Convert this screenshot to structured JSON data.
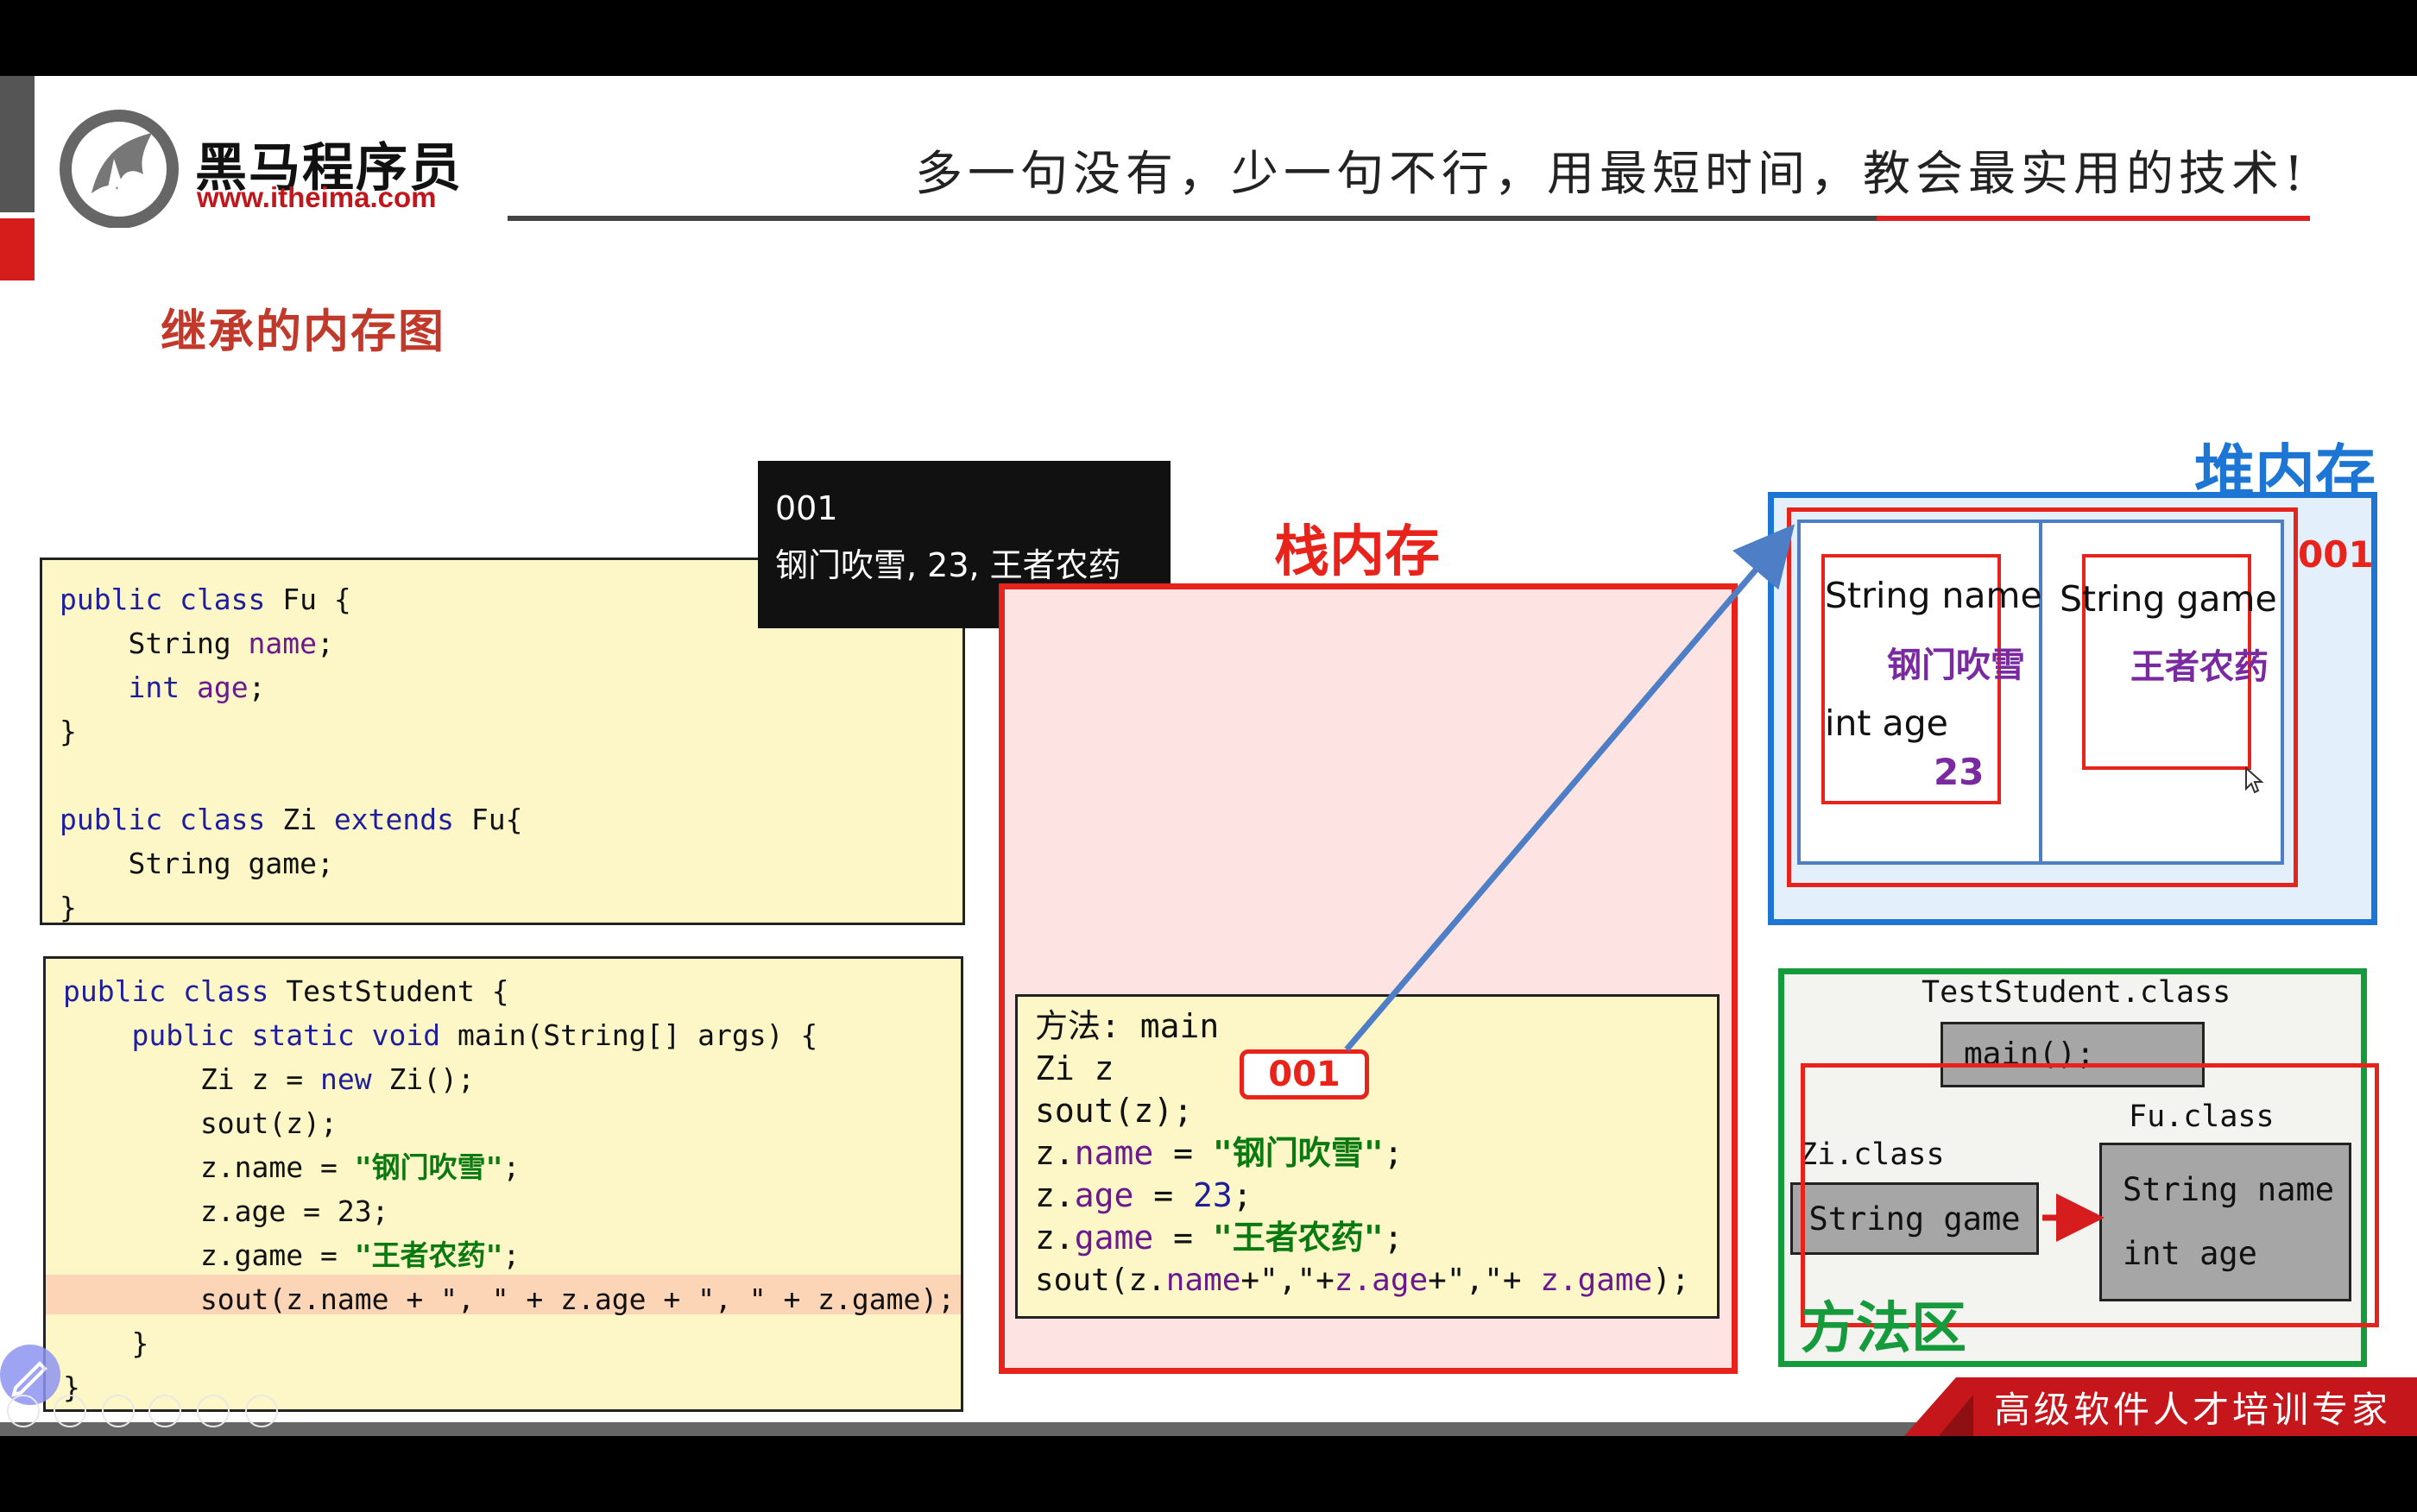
{
  "brand": {
    "logo_name": "黑马程序员",
    "url": "www.itheima.com",
    "slogan": "多一句没有，少一句不行，用最短时间，教会最实用的技术!",
    "footer": "高级软件人才培训专家"
  },
  "slide": {
    "title": "继承的内存图",
    "tooltip": {
      "line1": "001",
      "line2": "钢门吹雪, 23, 王者农药"
    },
    "stack_label": "栈内存",
    "heap_label": "堆内存",
    "method_area_label": "方法区"
  },
  "code_fu": {
    "l1a": "public class",
    "l1b": " Fu {",
    "l2a": "    String ",
    "l2b": "name",
    "l2c": ";",
    "l3a": "    int ",
    "l3b": "age",
    "l3c": ";",
    "l4": "}",
    "l5a": "public class",
    "l5b": " Zi ",
    "l5c": "extends",
    "l5d": " Fu{",
    "l6": "    String game;",
    "l7": "}"
  },
  "code_test": {
    "l1a": "public class",
    "l1b": " TestStudent {",
    "l2a": "    public static void",
    "l2b": " main(String[] args) {",
    "l3a": "        Zi z = ",
    "l3b": "new",
    "l3c": " Zi();",
    "l4": "        sout(z);",
    "l5a": "        z.name = ",
    "l5b": "\"钢门吹雪\"",
    "l5c": ";",
    "l6": "        z.age = 23;",
    "l7a": "        z.game = ",
    "l7b": "\"王者农药\"",
    "l7c": ";",
    "l8": "        sout(z.name + \", \" + z.age + \", \" + z.game);",
    "l9": "    }",
    "l10": "}"
  },
  "stack_frame": {
    "l1": "方法: main",
    "l2": "Zi z",
    "ref": "001",
    "l3": "sout(z);",
    "l4a": "z.",
    "l4b": "name",
    "l4c": " = ",
    "l4d": "\"钢门吹雪\"",
    "l4e": ";",
    "l5a": "z.",
    "l5b": "age",
    "l5c": " = ",
    "l5d": "23",
    "l5e": ";",
    "l6a": "z.",
    "l6b": "game",
    "l6c": " = ",
    "l6d": "\"王者农药\"",
    "l6e": ";",
    "l7a": "sout(z.",
    "l7b": "name",
    "l7c": "+\",\"+",
    "l7d": "z.age",
    "l7e": "+\",\"+ ",
    "l7f": "z.game",
    "l7g": ");"
  },
  "heap": {
    "address": "001",
    "field1_type": "String name",
    "field1_value": "钢门吹雪",
    "field2_type": "int age",
    "field2_value": "23",
    "field3_type": "String game",
    "field3_value": "王者农药"
  },
  "method_area": {
    "test_class": "TestStudent.class",
    "main_method": "main();",
    "zi_class": "Zi.class",
    "zi_field": "String game",
    "fu_class": "Fu.class",
    "fu_field1": "String name",
    "fu_field2": "int age"
  },
  "colors": {
    "red": "#e8231b",
    "blue": "#1e76d4",
    "green": "#159a3c",
    "code_bg": "#fdf7c8",
    "stack_bg": "#fde4e2",
    "heap_bg": "#e3f0fc"
  }
}
